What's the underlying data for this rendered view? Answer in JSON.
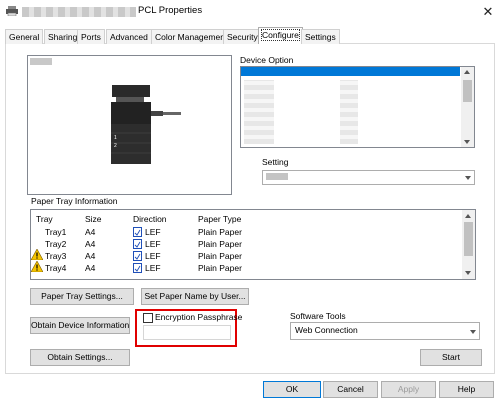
{
  "window": {
    "title": "PCL Properties",
    "close_glyph": "✕"
  },
  "tabs": [
    {
      "label": "General"
    },
    {
      "label": "Sharing"
    },
    {
      "label": "Ports"
    },
    {
      "label": "Advanced"
    },
    {
      "label": "Color Management"
    },
    {
      "label": "Security"
    },
    {
      "label": "Configure",
      "active": true
    },
    {
      "label": "Settings"
    }
  ],
  "device_option": {
    "label": "Device Option"
  },
  "setting": {
    "label": "Setting"
  },
  "paper_tray": {
    "group_label": "Paper Tray Information",
    "columns": [
      "Tray",
      "Size",
      "Direction",
      "Paper Type"
    ],
    "rows": [
      {
        "tray": "Tray1",
        "size": "A4",
        "direction": "LEF",
        "paper_type": "Plain Paper",
        "warning": false
      },
      {
        "tray": "Tray2",
        "size": "A4",
        "direction": "LEF",
        "paper_type": "Plain Paper",
        "warning": false
      },
      {
        "tray": "Tray3",
        "size": "A4",
        "direction": "LEF",
        "paper_type": "Plain Paper",
        "warning": true
      },
      {
        "tray": "Tray4",
        "size": "A4",
        "direction": "LEF",
        "paper_type": "Plain Paper",
        "warning": true
      }
    ],
    "settings_button": "Paper Tray Settings...",
    "set_name_button": "Set Paper Name by User..."
  },
  "buttons": {
    "obtain_device_info": "Obtain Device Information",
    "obtain_settings": "Obtain Settings...",
    "start": "Start",
    "ok": "OK",
    "cancel": "Cancel",
    "apply": "Apply",
    "help": "Help"
  },
  "encryption": {
    "label": "Encryption Passphrase",
    "checked": false,
    "value": ""
  },
  "software_tools": {
    "label": "Software Tools",
    "selected": "Web Connection"
  },
  "colors": {
    "accent": "#0078d7",
    "highlight": "#e00000",
    "warning": "#f5c400"
  }
}
